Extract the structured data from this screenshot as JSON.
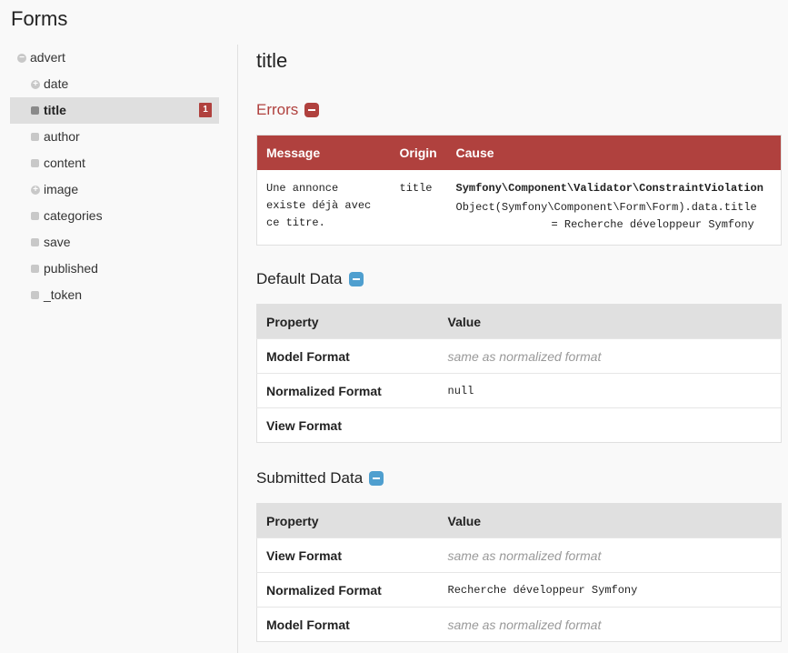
{
  "page": {
    "title": "Forms"
  },
  "sidebar": {
    "root": {
      "label": "advert",
      "toggle": "−"
    },
    "items": [
      {
        "label": "date",
        "type": "expandable",
        "toggle": "+"
      },
      {
        "label": "title",
        "type": "leaf",
        "active": true,
        "errors": "1"
      },
      {
        "label": "author",
        "type": "leaf"
      },
      {
        "label": "content",
        "type": "leaf"
      },
      {
        "label": "image",
        "type": "expandable",
        "toggle": "+"
      },
      {
        "label": "categories",
        "type": "leaf"
      },
      {
        "label": "save",
        "type": "leaf"
      },
      {
        "label": "published",
        "type": "leaf"
      },
      {
        "label": "_token",
        "type": "leaf"
      }
    ]
  },
  "main": {
    "field_title": "title",
    "errors": {
      "heading": "Errors",
      "headers": {
        "message": "Message",
        "origin": "Origin",
        "cause": "Cause"
      },
      "rows": [
        {
          "message_lines": [
            "Une annonce",
            "existe déjà avec",
            "ce titre."
          ],
          "origin": "title",
          "cause_class": "Symfony\\Component\\Validator\\ConstraintViolation",
          "cause_path": "Object(Symfony\\Component\\Form\\Form).data.title",
          "cause_value": "= Recherche développeur Symfony"
        }
      ]
    },
    "default_data": {
      "heading": "Default Data",
      "headers": {
        "property": "Property",
        "value": "Value"
      },
      "rows": [
        {
          "property": "Model Format",
          "value": "same as normalized format",
          "style": "muted"
        },
        {
          "property": "Normalized Format",
          "value": "null",
          "style": "code"
        },
        {
          "property": "View Format",
          "value": "",
          "style": "code"
        }
      ]
    },
    "submitted_data": {
      "heading": "Submitted Data",
      "headers": {
        "property": "Property",
        "value": "Value"
      },
      "rows": [
        {
          "property": "View Format",
          "value": "same as normalized format",
          "style": "muted"
        },
        {
          "property": "Normalized Format",
          "value": "Recherche développeur Symfony",
          "style": "code"
        },
        {
          "property": "Model Format",
          "value": "same as normalized format",
          "style": "muted"
        }
      ]
    }
  },
  "colors": {
    "error_red": "#b0413e",
    "toggle_blue": "#4f9fcf",
    "header_gray": "#e0e0e0"
  },
  "icons": {
    "collapse": "minus-square-icon",
    "expand": "plus-circle-icon",
    "bullet": "square-bullet-icon"
  }
}
